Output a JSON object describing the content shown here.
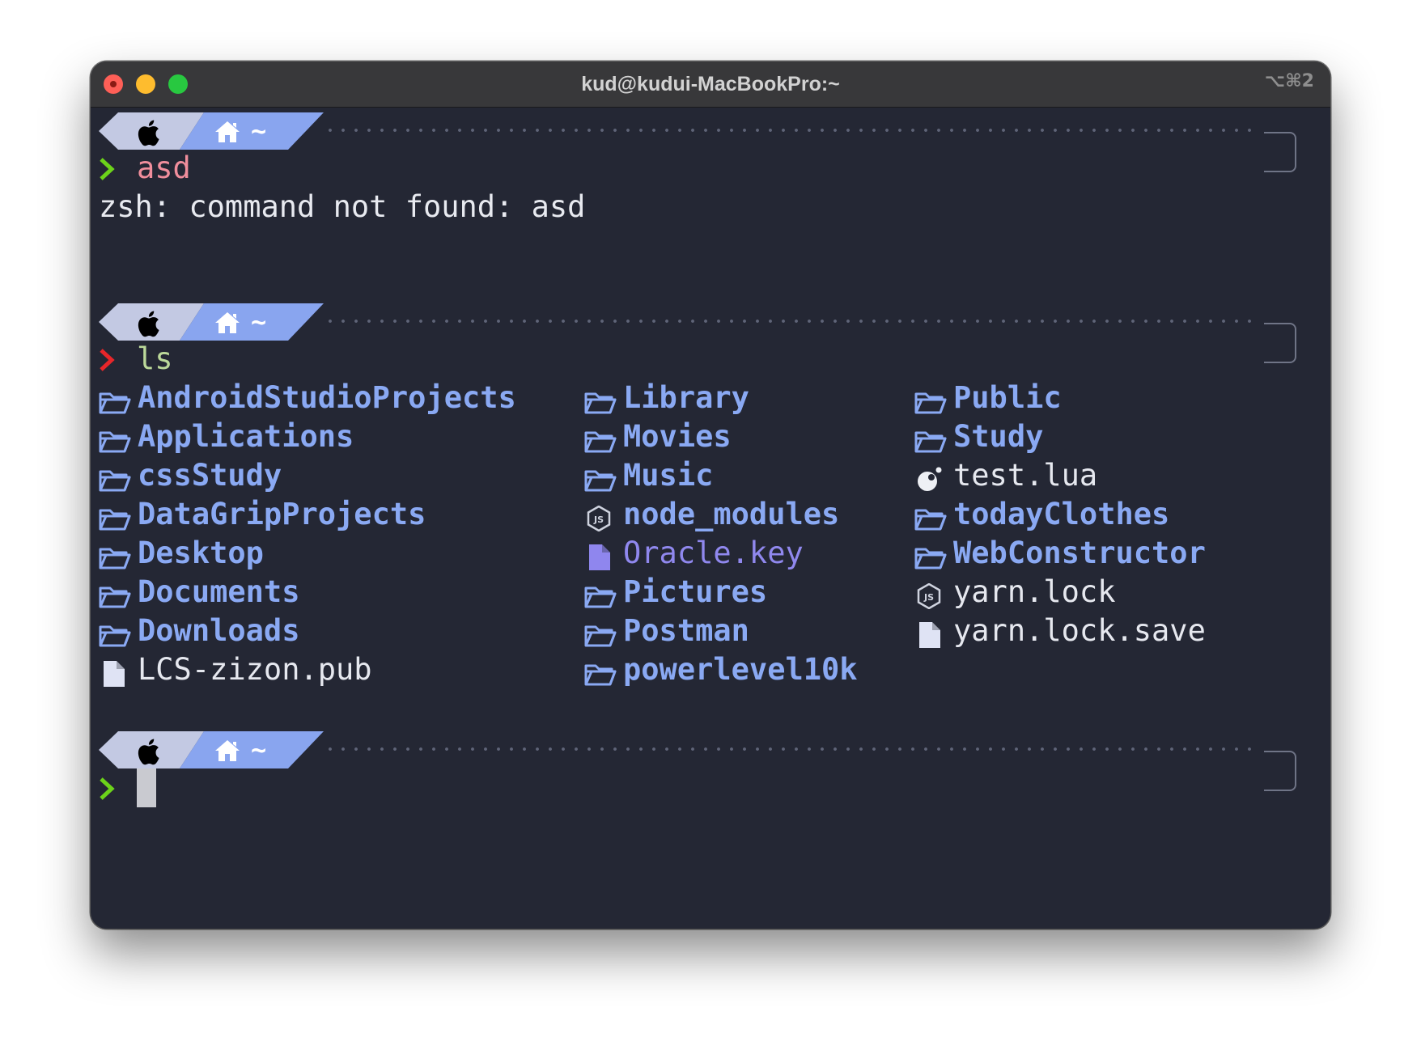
{
  "window": {
    "title": "kud@kudui-MacBookPro:~",
    "shortcut": "⌥⌘2"
  },
  "prompt": {
    "dir_label": "~",
    "icons": [
      "apple-icon",
      "home-icon"
    ],
    "colors": {
      "segment_apple": "#c3c9e3",
      "segment_home": "#89a5ef",
      "ok_chevron": "#6cd31a",
      "err_chevron": "#e8262a"
    }
  },
  "session": {
    "cmd1": "asd",
    "cmd1_output": "zsh: command not found: asd",
    "cmd2": "ls"
  },
  "listing": {
    "col1": [
      {
        "name": "AndroidStudioProjects",
        "icon": "folder-icon",
        "kind": "dir"
      },
      {
        "name": "Applications",
        "icon": "folder-icon",
        "kind": "dir"
      },
      {
        "name": "cssStudy",
        "icon": "folder-icon",
        "kind": "dir"
      },
      {
        "name": "DataGripProjects",
        "icon": "folder-icon",
        "kind": "dir"
      },
      {
        "name": "Desktop",
        "icon": "folder-icon",
        "kind": "dir"
      },
      {
        "name": "Documents",
        "icon": "folder-icon",
        "kind": "dir"
      },
      {
        "name": "Downloads",
        "icon": "folder-icon",
        "kind": "dir"
      },
      {
        "name": "LCS-zizon.pub",
        "icon": "file-icon",
        "kind": "file"
      }
    ],
    "col2": [
      {
        "name": "Library",
        "icon": "folder-icon",
        "kind": "dir"
      },
      {
        "name": "Movies",
        "icon": "folder-icon",
        "kind": "dir"
      },
      {
        "name": "Music",
        "icon": "folder-icon",
        "kind": "dir"
      },
      {
        "name": "node_modules",
        "icon": "nodejs-icon",
        "kind": "dir"
      },
      {
        "name": "Oracle.key",
        "icon": "file-icon",
        "kind": "key"
      },
      {
        "name": "Pictures",
        "icon": "folder-icon",
        "kind": "dir"
      },
      {
        "name": "Postman",
        "icon": "folder-icon",
        "kind": "dir"
      },
      {
        "name": "powerlevel10k",
        "icon": "folder-icon",
        "kind": "dir"
      }
    ],
    "col3": [
      {
        "name": "Public",
        "icon": "folder-icon",
        "kind": "dir"
      },
      {
        "name": "Study",
        "icon": "folder-icon",
        "kind": "dir"
      },
      {
        "name": "test.lua",
        "icon": "lua-icon",
        "kind": "file"
      },
      {
        "name": "todayClothes",
        "icon": "folder-icon",
        "kind": "dir"
      },
      {
        "name": "WebConstructor",
        "icon": "folder-icon",
        "kind": "dir"
      },
      {
        "name": "yarn.lock",
        "icon": "nodejs-icon",
        "kind": "file"
      },
      {
        "name": "yarn.lock.save",
        "icon": "file-icon",
        "kind": "file"
      }
    ]
  }
}
